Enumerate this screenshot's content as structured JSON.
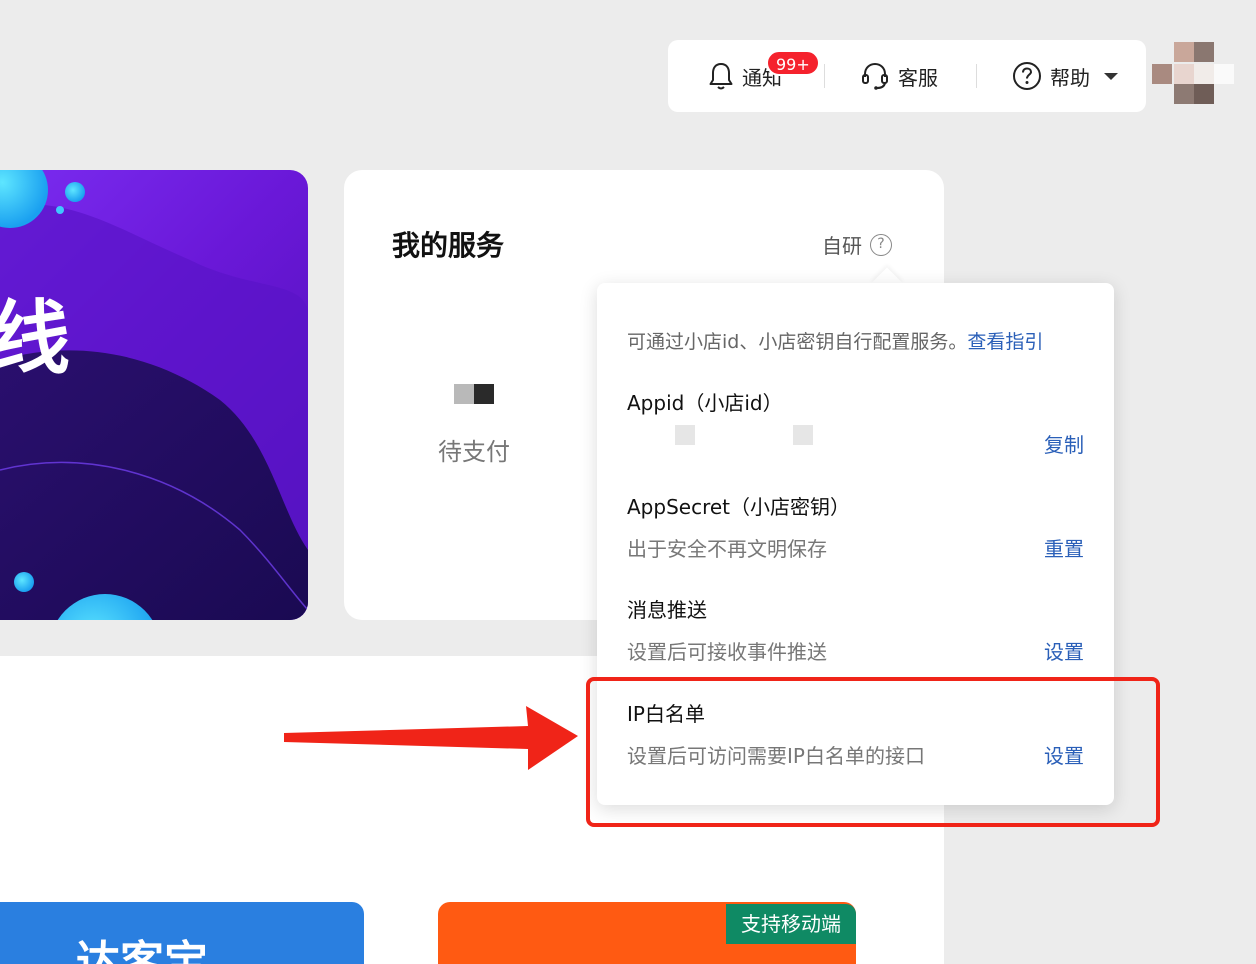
{
  "header": {
    "notify_label": "通知",
    "notify_badge": "99+",
    "service_label": "客服",
    "help_label": "帮助"
  },
  "banner": {
    "title": "线"
  },
  "service_card": {
    "title": "我的服务",
    "self_dev_label": "自研",
    "help_icon_text": "?",
    "order_status_label": "待支付"
  },
  "popover": {
    "description": "可通过小店id、小店密钥自行配置服务。",
    "guide_link": "查看指引",
    "sections": [
      {
        "title": "Appid（小店id）",
        "subtitle": "",
        "action": "复制"
      },
      {
        "title": "AppSecret（小店密钥）",
        "subtitle": "出于安全不再文明保存",
        "action": "重置"
      },
      {
        "title": "消息推送",
        "subtitle": "设置后可接收事件推送",
        "action": "设置"
      },
      {
        "title": "IP白名单",
        "subtitle": "设置后可访问需要IP白名单的接口",
        "action": "设置"
      }
    ]
  },
  "tiles": {
    "blue_title": "达客宝",
    "mobile_tag": "支持移动端"
  },
  "colors": {
    "link": "#2a5fb8",
    "badge": "#f5222d",
    "annotation_red": "#f02418",
    "banner_purple": "#6a18d8",
    "tag_green": "#0f8a64",
    "tile_orange": "#ff5a12",
    "tile_blue": "#2a7fe0"
  },
  "icons": {
    "notify": "bell-icon",
    "service": "headset-icon",
    "help": "question-circle-icon",
    "dropdown": "caret-down-icon"
  }
}
